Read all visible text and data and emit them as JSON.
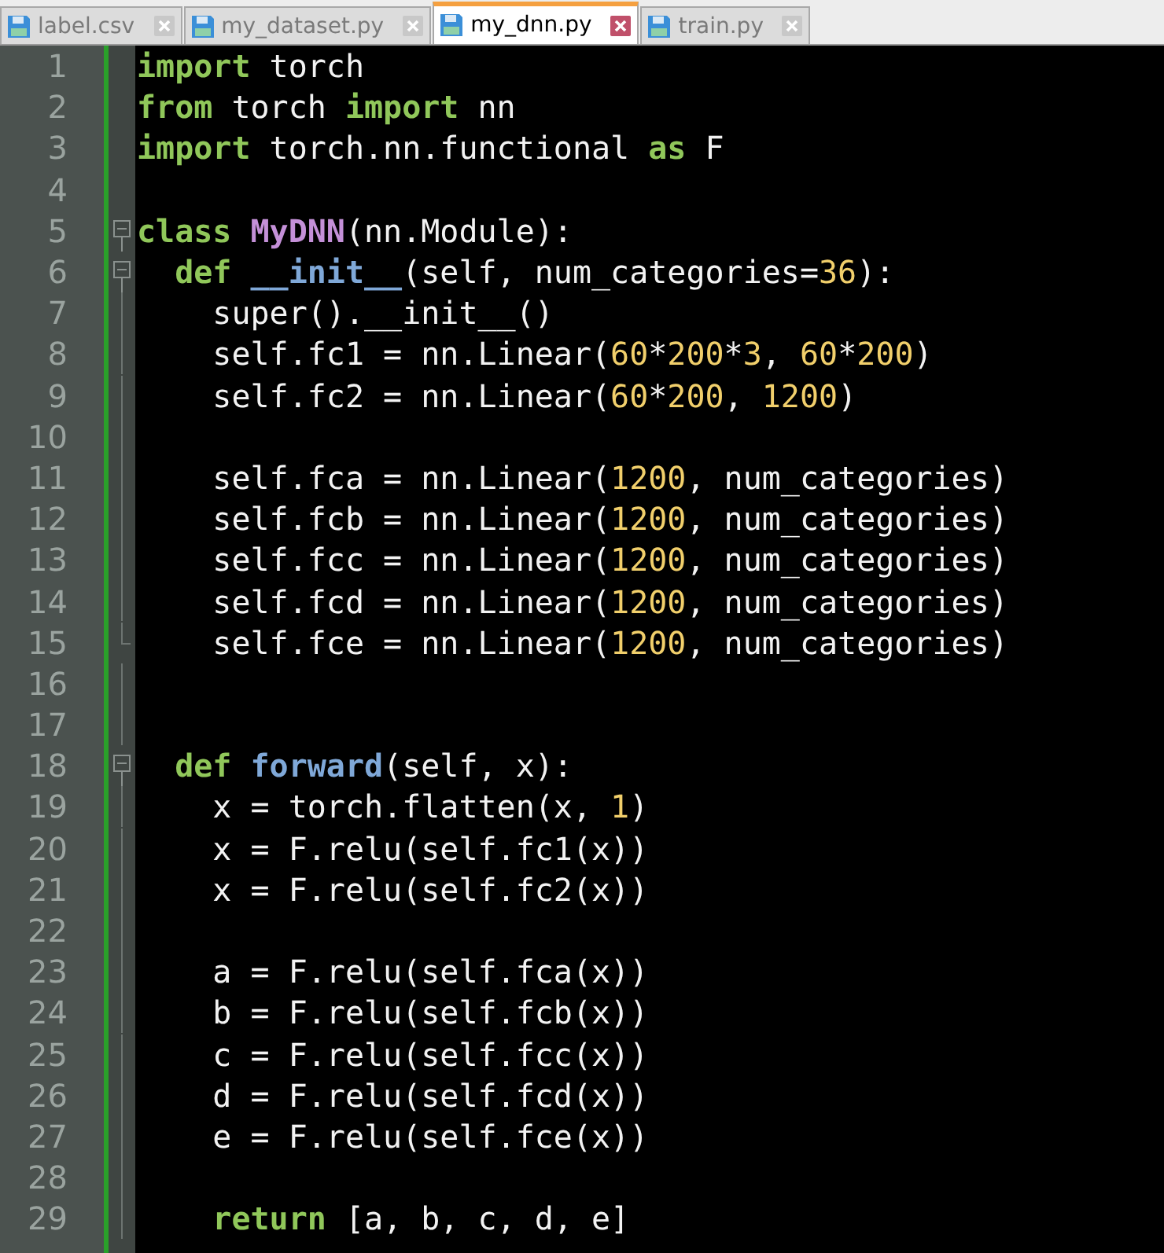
{
  "tabs": [
    {
      "label": "label.csv",
      "selected": false
    },
    {
      "label": "my_dataset.py",
      "selected": false
    },
    {
      "label": "my_dnn.py",
      "selected": true
    },
    {
      "label": "train.py",
      "selected": false
    }
  ],
  "lines": [
    {
      "number": "1",
      "tokens": [
        {
          "kind": "kw",
          "text": "import"
        },
        {
          "kind": "plain",
          "text": " torch"
        }
      ]
    },
    {
      "number": "2",
      "tokens": [
        {
          "kind": "kw",
          "text": "from"
        },
        {
          "kind": "plain",
          "text": " torch "
        },
        {
          "kind": "kw",
          "text": "import"
        },
        {
          "kind": "plain",
          "text": " nn"
        }
      ]
    },
    {
      "number": "3",
      "tokens": [
        {
          "kind": "kw",
          "text": "import"
        },
        {
          "kind": "plain",
          "text": " torch.nn.functional "
        },
        {
          "kind": "kw",
          "text": "as"
        },
        {
          "kind": "plain",
          "text": " F"
        }
      ]
    },
    {
      "number": "4"
    },
    {
      "number": "5",
      "fold_start": true,
      "tokens": [
        {
          "kind": "kw",
          "text": "class "
        },
        {
          "kind": "cls",
          "text": "MyDNN"
        },
        {
          "kind": "plain",
          "text": "(nn.Module):"
        }
      ]
    },
    {
      "number": "6",
      "fold_start": true,
      "tokens": [
        {
          "kind": "kw",
          "text": "  def "
        },
        {
          "kind": "fn",
          "text": "__init__"
        },
        {
          "kind": "plain",
          "text": "(self, num_categories="
        },
        {
          "kind": "num",
          "text": "36"
        },
        {
          "kind": "plain",
          "text": "):"
        }
      ]
    },
    {
      "number": "7",
      "fold_guide": true,
      "tokens": [
        {
          "kind": "plain",
          "text": "    super().__init__()"
        }
      ]
    },
    {
      "number": "8",
      "fold_guide": true,
      "tokens": [
        {
          "kind": "plain",
          "text": "    self.fc1 = nn.Linear("
        },
        {
          "kind": "num",
          "text": "60"
        },
        {
          "kind": "plain",
          "text": "*"
        },
        {
          "kind": "num",
          "text": "200"
        },
        {
          "kind": "plain",
          "text": "*"
        },
        {
          "kind": "num",
          "text": "3"
        },
        {
          "kind": "plain",
          "text": ", "
        },
        {
          "kind": "num",
          "text": "60"
        },
        {
          "kind": "plain",
          "text": "*"
        },
        {
          "kind": "num",
          "text": "200"
        },
        {
          "kind": "plain",
          "text": ")"
        }
      ]
    },
    {
      "number": "9",
      "fold_guide": true,
      "tokens": [
        {
          "kind": "plain",
          "text": "    self.fc2 = nn.Linear("
        },
        {
          "kind": "num",
          "text": "60"
        },
        {
          "kind": "plain",
          "text": "*"
        },
        {
          "kind": "num",
          "text": "200"
        },
        {
          "kind": "plain",
          "text": ", "
        },
        {
          "kind": "num",
          "text": "1200"
        },
        {
          "kind": "plain",
          "text": ")"
        }
      ]
    },
    {
      "number": "10",
      "fold_guide": true
    },
    {
      "number": "11",
      "fold_guide": true,
      "tokens": [
        {
          "kind": "plain",
          "text": "    self.fca = nn.Linear("
        },
        {
          "kind": "num",
          "text": "1200"
        },
        {
          "kind": "plain",
          "text": ", num_categories)"
        }
      ]
    },
    {
      "number": "12",
      "fold_guide": true,
      "tokens": [
        {
          "kind": "plain",
          "text": "    self.fcb = nn.Linear("
        },
        {
          "kind": "num",
          "text": "1200"
        },
        {
          "kind": "plain",
          "text": ", num_categories)"
        }
      ]
    },
    {
      "number": "13",
      "fold_guide": true,
      "tokens": [
        {
          "kind": "plain",
          "text": "    self.fcc = nn.Linear("
        },
        {
          "kind": "num",
          "text": "1200"
        },
        {
          "kind": "plain",
          "text": ", num_categories)"
        }
      ]
    },
    {
      "number": "14",
      "fold_guide": true,
      "tokens": [
        {
          "kind": "plain",
          "text": "    self.fcd = nn.Linear("
        },
        {
          "kind": "num",
          "text": "1200"
        },
        {
          "kind": "plain",
          "text": ", num_categories)"
        }
      ]
    },
    {
      "number": "15",
      "fold_end": true,
      "tokens": [
        {
          "kind": "plain",
          "text": "    self.fce = nn.Linear("
        },
        {
          "kind": "num",
          "text": "1200"
        },
        {
          "kind": "plain",
          "text": ", num_categories)"
        }
      ]
    },
    {
      "number": "16",
      "fold_guide": true
    },
    {
      "number": "17",
      "fold_guide": true
    },
    {
      "number": "18",
      "fold_start": true,
      "tokens": [
        {
          "kind": "kw",
          "text": "  def "
        },
        {
          "kind": "fn",
          "text": "forward"
        },
        {
          "kind": "plain",
          "text": "(self, x):"
        }
      ]
    },
    {
      "number": "19",
      "fold_guide": true,
      "tokens": [
        {
          "kind": "plain",
          "text": "    x = torch.flatten(x, "
        },
        {
          "kind": "num",
          "text": "1"
        },
        {
          "kind": "plain",
          "text": ")"
        }
      ]
    },
    {
      "number": "20",
      "fold_guide": true,
      "tokens": [
        {
          "kind": "plain",
          "text": "    x = F.relu(self.fc1(x))"
        }
      ]
    },
    {
      "number": "21",
      "fold_guide": true,
      "tokens": [
        {
          "kind": "plain",
          "text": "    x = F.relu(self.fc2(x))"
        }
      ]
    },
    {
      "number": "22",
      "fold_guide": true
    },
    {
      "number": "23",
      "fold_guide": true,
      "tokens": [
        {
          "kind": "plain",
          "text": "    a = F.relu(self.fca(x))"
        }
      ]
    },
    {
      "number": "24",
      "fold_guide": true,
      "tokens": [
        {
          "kind": "plain",
          "text": "    b = F.relu(self.fcb(x))"
        }
      ]
    },
    {
      "number": "25",
      "fold_guide": true,
      "tokens": [
        {
          "kind": "plain",
          "text": "    c = F.relu(self.fcc(x))"
        }
      ]
    },
    {
      "number": "26",
      "fold_guide": true,
      "tokens": [
        {
          "kind": "plain",
          "text": "    d = F.relu(self.fcd(x))"
        }
      ]
    },
    {
      "number": "27",
      "fold_guide": true,
      "tokens": [
        {
          "kind": "plain",
          "text": "    e = F.relu(self.fce(x))"
        }
      ]
    },
    {
      "number": "28",
      "fold_guide": true
    },
    {
      "number": "29",
      "fold_guide": true,
      "tokens": [
        {
          "kind": "kw",
          "text": "    return"
        },
        {
          "kind": "plain",
          "text": " [a, b, c, d, e]"
        }
      ]
    }
  ]
}
